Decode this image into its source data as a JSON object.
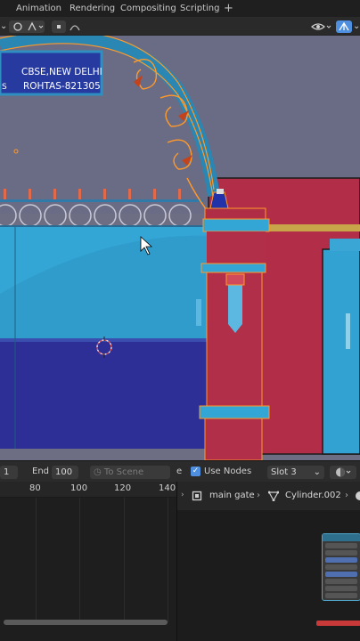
{
  "workspace_tabs": [
    "Animation",
    "Rendering",
    "Compositing",
    "Scripting"
  ],
  "add_tab_label": "+",
  "sign": {
    "line1": "CBSE,NEW DELHI",
    "line2": "ROHTAS-821305",
    "left_char": "S"
  },
  "timeline": {
    "start_value": "1",
    "end_label": "End",
    "end_value": "100",
    "scene_range_label": "To Scene Range",
    "ruler_ticks": [
      "80",
      "100",
      "120",
      "140"
    ]
  },
  "node_editor": {
    "editor_letter": "e",
    "use_nodes_label": "Use Nodes",
    "use_nodes_checked": true,
    "slot_value": "Slot 3",
    "breadcrumb_object": "main gate",
    "breadcrumb_mesh": "Cylinder.002"
  },
  "colors": {
    "accent_blue": "#4f8fe0",
    "gate_red": "#b32c48",
    "wall_cyan": "#35a5d4",
    "wall_navy": "#2d2d93",
    "selection_orange": "#ff9a2a"
  },
  "icons": [
    "cursor-arrow-icon",
    "3d-cursor-icon",
    "visibility-eye-icon",
    "gizmo-icon",
    "overlay-icon",
    "shading-sphere-icon",
    "object-icon",
    "mesh-icon",
    "material-sphere-icon"
  ]
}
